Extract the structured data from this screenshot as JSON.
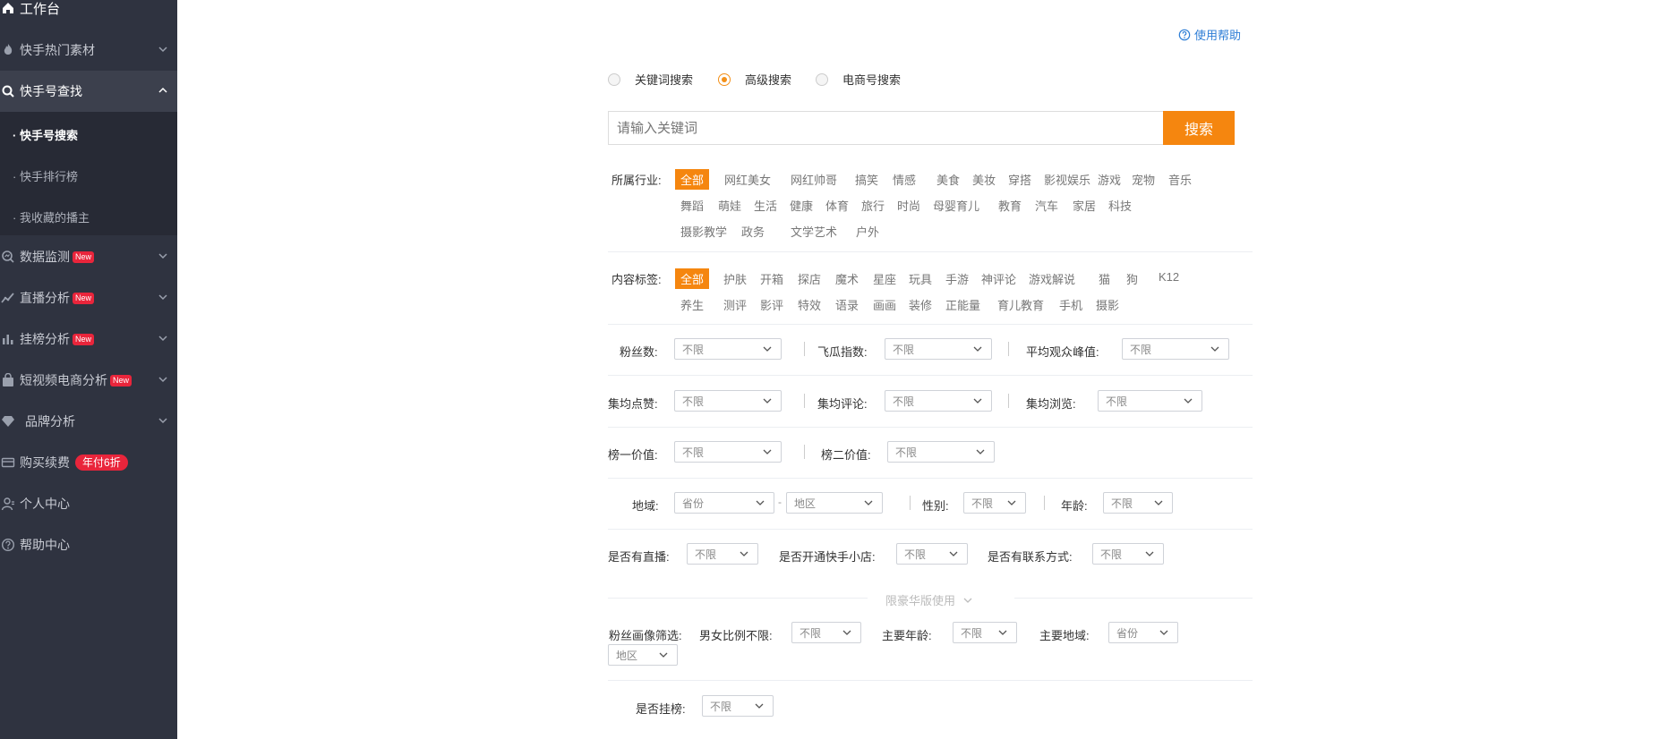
{
  "sidebar": {
    "top": {
      "label": "工作台",
      "icon": "home-icon"
    },
    "items": [
      {
        "label": "快手热门素材",
        "icon": "flame-icon"
      },
      {
        "label": "快手号查找",
        "icon": "search-icon"
      },
      {
        "label": "数据监测",
        "icon": "monitor-icon",
        "badge": "New"
      },
      {
        "label": "直播分析",
        "icon": "trend-icon",
        "badge": "New"
      },
      {
        "label": "挂榜分析",
        "icon": "bar-chart-icon",
        "badge": "New"
      },
      {
        "label": "短视频电商分析",
        "icon": "bag-icon",
        "badge": "New"
      },
      {
        "label": "品牌分析",
        "icon": "diamond-icon"
      },
      {
        "label": "购买续费",
        "icon": "card-icon",
        "promo": "年付6折"
      },
      {
        "label": "个人中心",
        "icon": "user-icon"
      },
      {
        "label": "帮助中心",
        "icon": "help-icon"
      }
    ],
    "subitems": [
      "· 快手号搜索",
      "· 快手排行榜",
      "· 我收藏的播主"
    ]
  },
  "help": {
    "label": "使用帮助"
  },
  "search_modes": [
    "关键词搜索",
    "高级搜索",
    "电商号搜索"
  ],
  "search": {
    "placeholder": "请输入关键词",
    "button": "搜索"
  },
  "industry": {
    "label": "所属行业:",
    "tags": [
      "全部",
      "网红美女",
      "网红帅哥",
      "搞笑",
      "情感",
      "美食",
      "美妆",
      "穿搭",
      "影视娱乐",
      "游戏",
      "宠物",
      "音乐",
      "舞蹈",
      "萌娃",
      "生活",
      "健康",
      "体育",
      "旅行",
      "时尚",
      "母婴育儿",
      "教育",
      "汽车",
      "家居",
      "科技",
      "摄影教学",
      "政务",
      "文学艺术",
      "户外"
    ]
  },
  "content_tags": {
    "label": "内容标签:",
    "tags": [
      "全部",
      "护肤",
      "开箱",
      "探店",
      "魔术",
      "星座",
      "玩具",
      "手游",
      "神评论",
      "游戏解说",
      "猫",
      "狗",
      "K12",
      "养生",
      "测评",
      "影评",
      "特效",
      "语录",
      "画画",
      "装修",
      "正能量",
      "育儿教育",
      "手机",
      "摄影"
    ]
  },
  "filters": {
    "fans": {
      "label": "粉丝数:",
      "value": "不限"
    },
    "feigua": {
      "label": "飞瓜指数:",
      "value": "不限"
    },
    "peak": {
      "label": "平均观众峰值:",
      "value": "不限"
    },
    "likes": {
      "label": "集均点赞:",
      "value": "不限"
    },
    "comments": {
      "label": "集均评论:",
      "value": "不限"
    },
    "views": {
      "label": "集均浏览:",
      "value": "不限"
    },
    "rank1": {
      "label": "榜一价值:",
      "value": "不限"
    },
    "rank2": {
      "label": "榜二价值:",
      "value": "不限"
    },
    "region": {
      "label": "地域:",
      "province": "省份",
      "area": "地区",
      "dash": "-"
    },
    "gender": {
      "label": "性别:",
      "value": "不限"
    },
    "age": {
      "label": "年龄:",
      "value": "不限"
    },
    "live": {
      "label": "是否有直播:",
      "value": "不限"
    },
    "shop": {
      "label": "是否开通快手小店:",
      "value": "不限"
    },
    "contact": {
      "label": "是否有联系方式:",
      "value": "不限"
    },
    "premium": {
      "label": "限豪华版使用"
    },
    "portrait": {
      "label": "粉丝画像筛选:",
      "ratio": {
        "label": "男女比例不限:",
        "value": "不限"
      },
      "main_age": {
        "label": "主要年龄:",
        "value": "不限"
      },
      "main_region": {
        "label": "主要地域:",
        "province": "省份",
        "area": "地区"
      }
    },
    "ranked": {
      "label": "是否挂榜:",
      "value": "不限"
    }
  }
}
